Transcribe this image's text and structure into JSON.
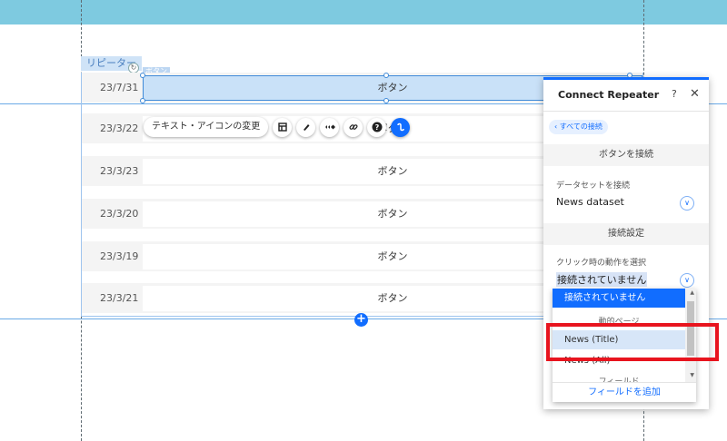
{
  "canvas": {
    "repeater_label": "リピーター",
    "button_tag": "ボタン",
    "rotate_icon": "rotate-icon",
    "rows": [
      {
        "date": "23/7/31",
        "button": "ボタン"
      },
      {
        "date": "23/3/22",
        "button": "ボタン"
      },
      {
        "date": "23/3/23",
        "button": "ボタン"
      },
      {
        "date": "23/3/20",
        "button": "ボタン"
      },
      {
        "date": "23/3/19",
        "button": "ボタン"
      },
      {
        "date": "23/3/21",
        "button": "ボタン"
      }
    ],
    "add_button": "+"
  },
  "toolbar": {
    "change_text_icon_label": "テキスト・アイコンの変更",
    "icons": [
      "layout-icon",
      "design-brush-icon",
      "animation-icon",
      "link-icon",
      "help-icon",
      "connect-data-icon"
    ]
  },
  "panel": {
    "title": "Connect Repeater",
    "help": "?",
    "close": "✕",
    "back_chip": "‹ すべての接続",
    "section_connect_button": "ボタンを接続",
    "dataset_label": "データセットを接続",
    "dataset_value": "News dataset",
    "section_settings": "接続設定",
    "click_action_label": "クリック時の動作を選択",
    "click_action_value": "接続されていません"
  },
  "dropdown": {
    "selected_option": "接続されていません",
    "group_dynamic_pages": "動的ページ",
    "options": [
      "News (Title)",
      "News (All)"
    ],
    "group_fields": "フィールド",
    "footer_link": "フィールドを追加"
  },
  "colors": {
    "accent": "#116dff",
    "header_band": "#7ecae0",
    "highlight_red": "#e8141e"
  }
}
